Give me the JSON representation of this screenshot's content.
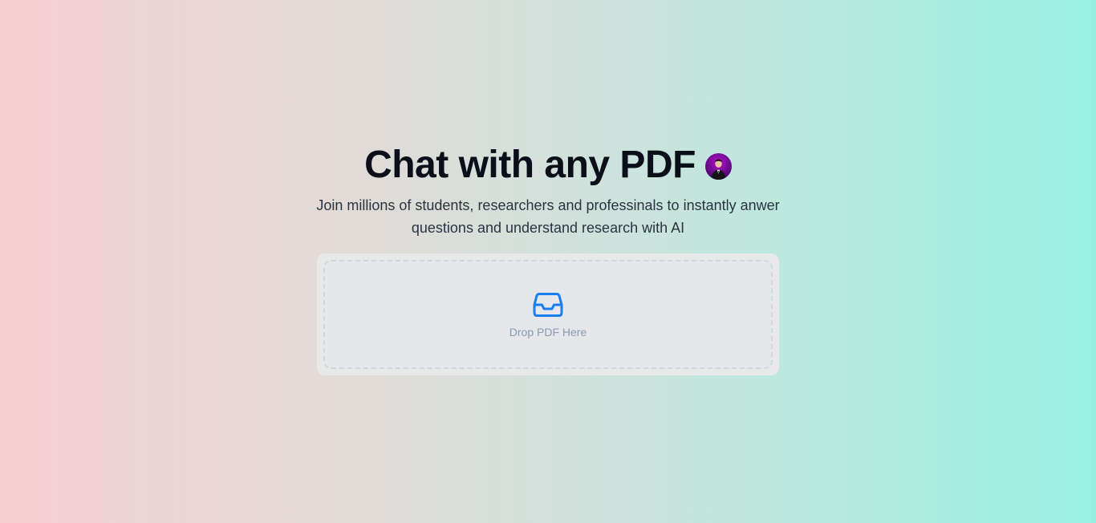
{
  "hero": {
    "title": "Chat with any PDF",
    "subtitle": "Join millions of students, researchers and professinals to instantly anwer questions and understand research with AI",
    "avatar_icon": "user-avatar"
  },
  "dropzone": {
    "icon": "inbox-icon",
    "label": "Drop PDF Here",
    "accent_color": "#1a7ef2"
  },
  "colors": {
    "background_left": "#f6cfd3",
    "background_right": "#96f0e0",
    "title": "#0b0f19"
  }
}
